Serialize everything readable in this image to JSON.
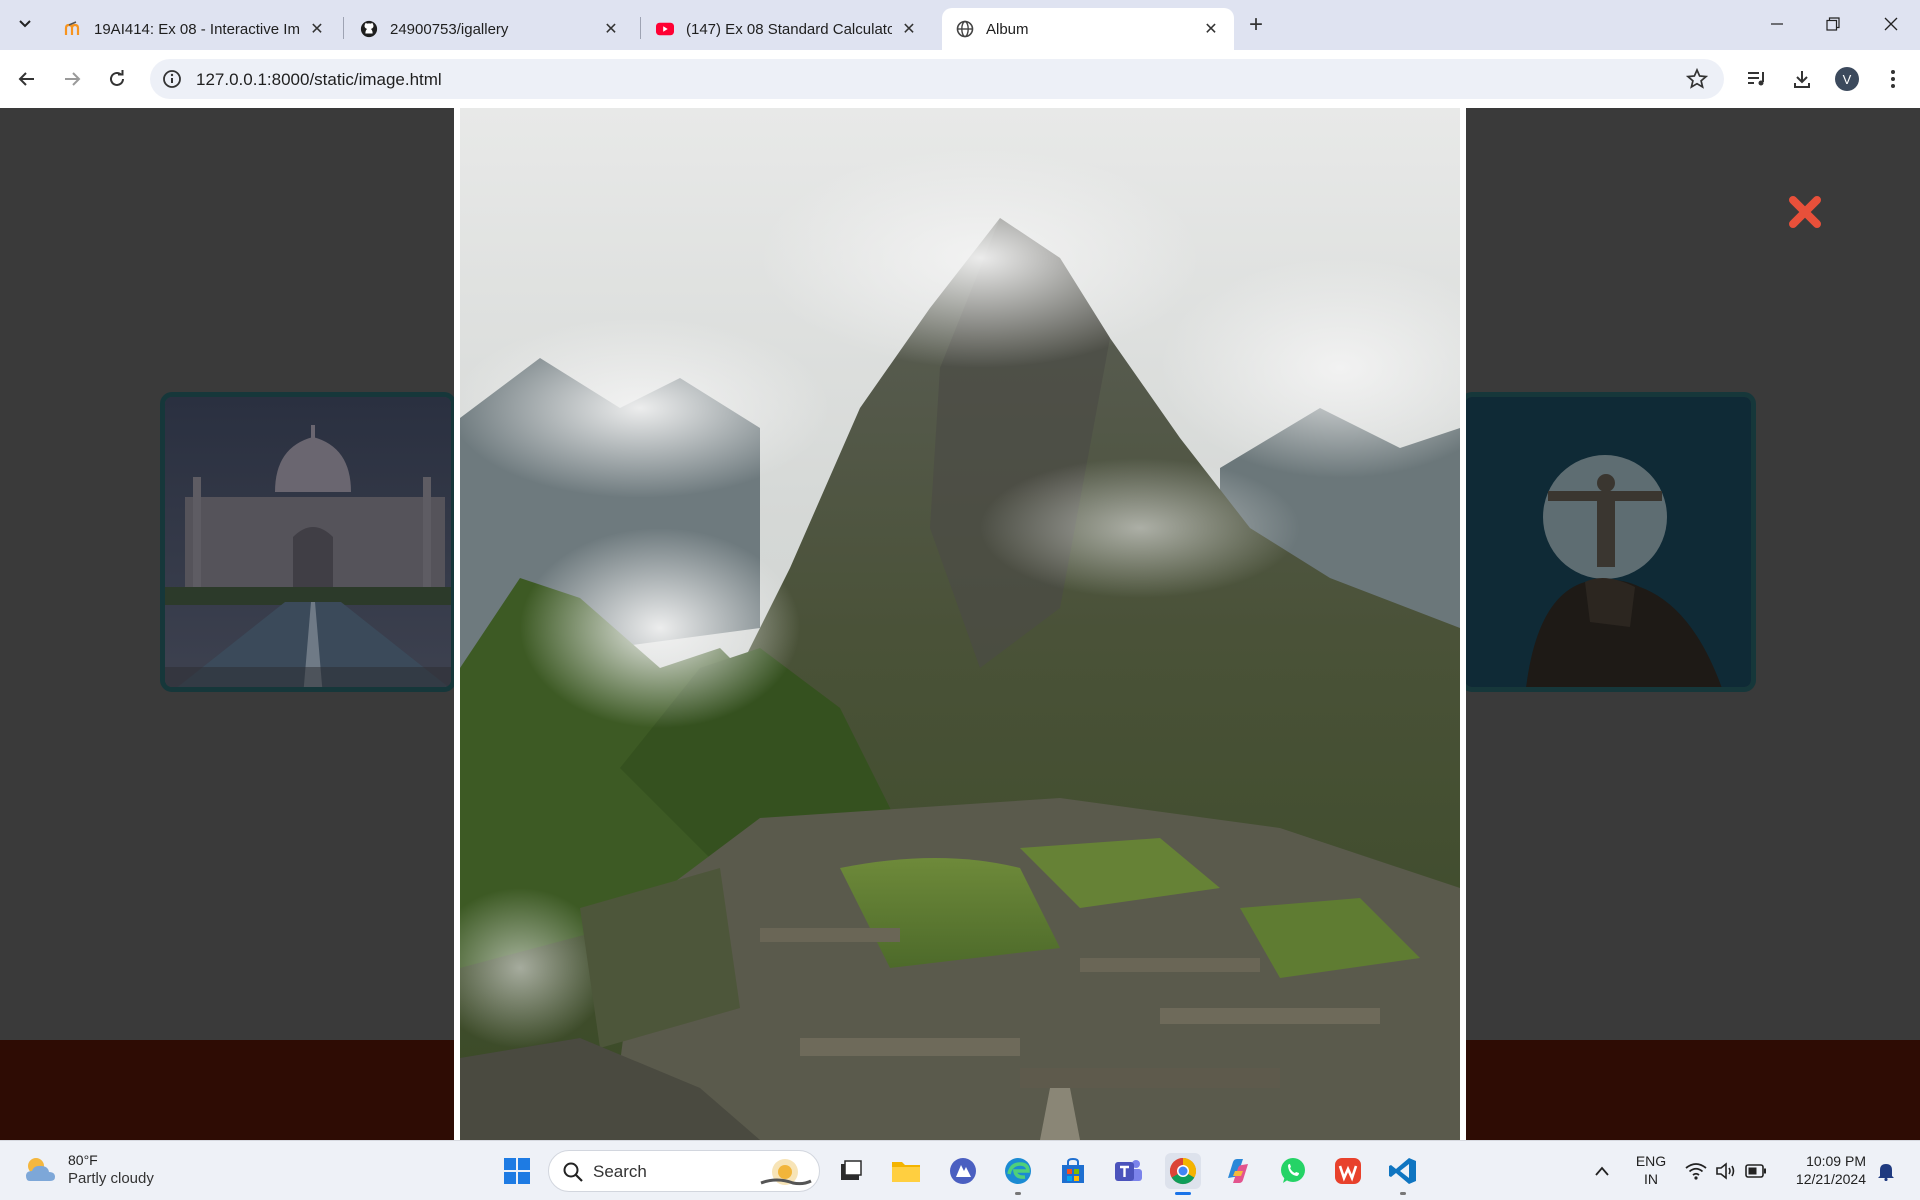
{
  "browser": {
    "tabs": [
      {
        "title": "19AI414: Ex 08 - Interactive Ima",
        "favicon": "moodle-icon",
        "active": false
      },
      {
        "title": "24900753/igallery",
        "favicon": "github-icon",
        "active": false
      },
      {
        "title": "(147) Ex 08 Standard Calculator",
        "favicon": "youtube-icon",
        "active": false
      },
      {
        "title": "Album",
        "favicon": "globe-icon",
        "active": true
      }
    ],
    "url": "127.0.0.1:8000/static/image.html",
    "profile_initial": "V"
  },
  "page": {
    "lightbox_image": "machu-picchu-mountain-photo",
    "left_thumbnail": "taj-mahal-photo",
    "right_thumbnail": "christ-the-redeemer-moon-photo",
    "close_icon_color": "#e8503a",
    "footer_color": "#2e0c04"
  },
  "taskbar": {
    "weather": {
      "temp": "80°F",
      "condition": "Partly cloudy"
    },
    "search_label": "Search",
    "apps": [
      "windows-start",
      "search",
      "task-view",
      "file-explorer",
      "app-launcher",
      "edge",
      "microsoft-store",
      "teams",
      "chrome",
      "copilot",
      "whatsapp",
      "wps-office",
      "vs-code"
    ],
    "tray": {
      "lang_top": "ENG",
      "lang_bottom": "IN",
      "time": "10:09 PM",
      "date": "12/21/2024"
    }
  }
}
